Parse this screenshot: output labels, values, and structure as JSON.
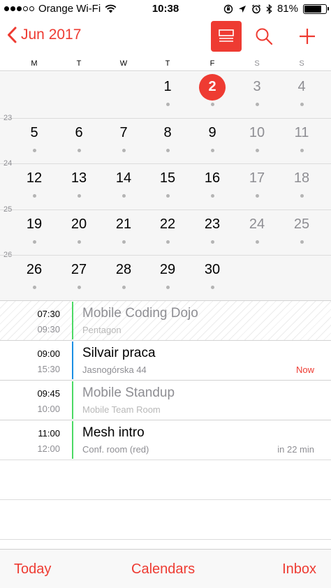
{
  "status": {
    "carrier": "Orange Wi-Fi",
    "time": "10:38",
    "battery": "81%",
    "battery_level": 0.81,
    "icons": [
      "wifi-icon",
      "orientation-lock-icon",
      "location-arrow-icon",
      "alarm-icon",
      "bluetooth-icon",
      "battery-icon"
    ]
  },
  "nav": {
    "back_label": "Jun 2017",
    "icons": [
      "chevron-left-icon",
      "list-view-icon",
      "search-icon",
      "plus-icon"
    ]
  },
  "weekdays": [
    "M",
    "T",
    "W",
    "T",
    "F",
    "S",
    "S"
  ],
  "weeks": [
    {
      "number": "",
      "days": [
        "",
        "",
        "",
        "1",
        "2",
        "3",
        "4"
      ]
    },
    {
      "number": "23",
      "days": [
        "5",
        "6",
        "7",
        "8",
        "9",
        "10",
        "11"
      ]
    },
    {
      "number": "24",
      "days": [
        "12",
        "13",
        "14",
        "15",
        "16",
        "17",
        "18"
      ]
    },
    {
      "number": "25",
      "days": [
        "19",
        "20",
        "21",
        "22",
        "23",
        "24",
        "25"
      ]
    },
    {
      "number": "26",
      "days": [
        "26",
        "27",
        "28",
        "29",
        "30",
        "",
        ""
      ]
    }
  ],
  "today": "2",
  "events": [
    {
      "start": "07:30",
      "end": "09:30",
      "title": "Mobile Coding Dojo",
      "location": "Pentagon",
      "badge": "",
      "color": "#4cd964",
      "past": true
    },
    {
      "start": "09:00",
      "end": "15:30",
      "title": "Silvair praca",
      "location": "Jasnogórska 44",
      "badge": "Now",
      "color": "#1a8fe3",
      "past": false
    },
    {
      "start": "09:45",
      "end": "10:00",
      "title": "Mobile Standup",
      "location": "Mobile Team Room",
      "badge": "",
      "color": "#4cd964",
      "past": false,
      "muted": true
    },
    {
      "start": "11:00",
      "end": "12:00",
      "title": "Mesh intro",
      "location": "Conf. room (red)",
      "badge": "in 22 min",
      "color": "#4cd964",
      "past": false
    }
  ],
  "tabs": {
    "today": "Today",
    "calendars": "Calendars",
    "inbox": "Inbox"
  },
  "colors": {
    "accent": "#ee3b32"
  }
}
